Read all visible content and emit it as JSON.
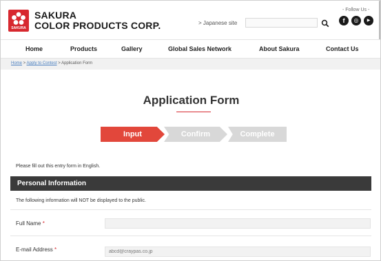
{
  "header": {
    "logo_small": "SAKURA",
    "brand_line1": "SAKURA",
    "brand_line2": "COLOR PRODUCTS CORP.",
    "japanese_site": "> Japanese site",
    "search_placeholder": "",
    "follow_label": "- Follow Us -",
    "sns": [
      {
        "name": "facebook",
        "glyph": "f"
      },
      {
        "name": "instagram",
        "glyph": "◎"
      },
      {
        "name": "youtube",
        "glyph": "▶"
      }
    ]
  },
  "nav": {
    "items": [
      "Home",
      "Products",
      "Gallery",
      "Global Sales Network",
      "About Sakura",
      "Contact Us"
    ]
  },
  "breadcrumb": {
    "home": "Home",
    "sep1": " > ",
    "apply": "Apply to Contest",
    "sep2": " > ",
    "current": "Application Form"
  },
  "page": {
    "title": "Application Form",
    "steps": [
      "Input",
      "Confirm",
      "Complete"
    ],
    "active_step": "Input",
    "instruction": "Please fill out this entry form in English."
  },
  "personal": {
    "heading": "Personal Information",
    "notice": "The following information will NOT be displayed to the public.",
    "fields": [
      {
        "label": "Full Name",
        "required": "*",
        "value": "",
        "placeholder": ""
      },
      {
        "label": "E-mail Address",
        "required": "*",
        "value": "",
        "placeholder": "abcd@craypas.co.jp"
      }
    ]
  },
  "colors": {
    "brand_red": "#d7282f",
    "step_active": "#e2473b",
    "step_inactive": "#d8d8d8",
    "section_bar": "#3a3a3a"
  }
}
